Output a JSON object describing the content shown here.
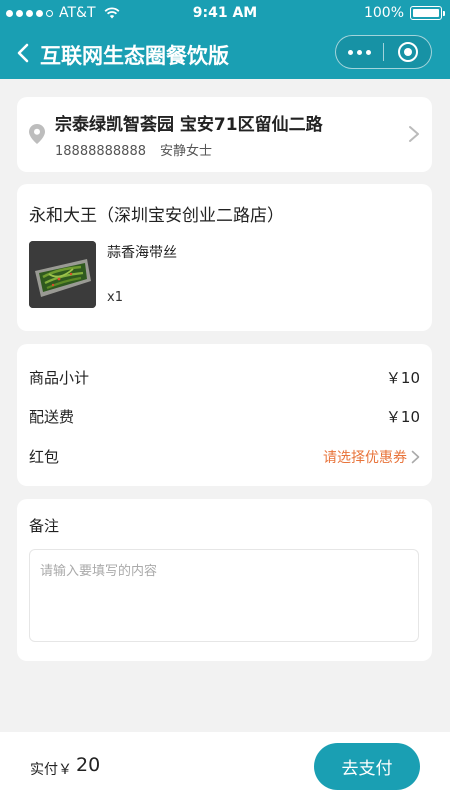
{
  "status_bar": {
    "carrier": "AT&T",
    "time": "9:41 AM",
    "battery": "100%"
  },
  "nav": {
    "title": "互联网生态圈餐饮版"
  },
  "address": {
    "line": "宗泰绿凯智荟园 宝安71区留仙二路",
    "phone": "18888888888",
    "name": "安静女士"
  },
  "order": {
    "shop_name": "永和大王（深圳宝安创业二路店）",
    "items": [
      {
        "name": "蒜香海带丝",
        "qty": "x1"
      }
    ]
  },
  "price": {
    "subtotal_label": "商品小计",
    "subtotal_value": "￥10",
    "delivery_label": "配送费",
    "delivery_value": "￥10",
    "coupon_label": "红包",
    "coupon_action": "请选择优惠券"
  },
  "note": {
    "title": "备注",
    "placeholder": "请输入要填写的内容",
    "value": ""
  },
  "footer": {
    "pay_label": "实付￥",
    "pay_amount": "20",
    "pay_button": "去支付"
  },
  "colors": {
    "accent": "#1a9fb3",
    "coupon": "#e8743b",
    "background": "#f2f2f2"
  }
}
